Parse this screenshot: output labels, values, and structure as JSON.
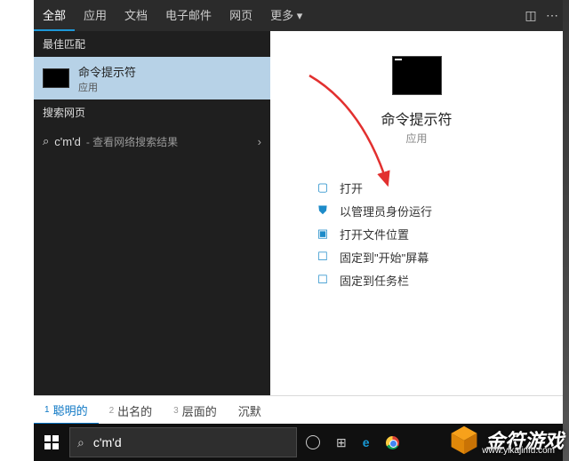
{
  "topbar": {
    "tabs": [
      "全部",
      "应用",
      "文档",
      "电子邮件",
      "网页",
      "更多 ▾"
    ],
    "active_index": 0
  },
  "left": {
    "best_match_header": "最佳匹配",
    "best_title": "命令提示符",
    "best_sub": "应用",
    "web_header": "搜索网页",
    "web_query": "c'm'd",
    "web_hint": "- 查看网络搜索结果"
  },
  "right": {
    "title": "命令提示符",
    "sub": "应用",
    "actions": [
      {
        "icon": "open",
        "label": "打开"
      },
      {
        "icon": "admin",
        "label": "以管理员身份运行"
      },
      {
        "icon": "folder",
        "label": "打开文件位置"
      },
      {
        "icon": "pin-start",
        "label": "固定到\"开始\"屏幕"
      },
      {
        "icon": "pin-task",
        "label": "固定到任务栏"
      }
    ]
  },
  "suggestions": [
    {
      "n": "1",
      "t": "聪明的"
    },
    {
      "n": "2",
      "t": "出名的"
    },
    {
      "n": "3",
      "t": "层面的"
    },
    {
      "n": "",
      "t": "沉默"
    }
  ],
  "search": {
    "value": "c'm'd"
  },
  "brand": {
    "name": "金符游戏",
    "url": "www.yikajinfu.com"
  }
}
